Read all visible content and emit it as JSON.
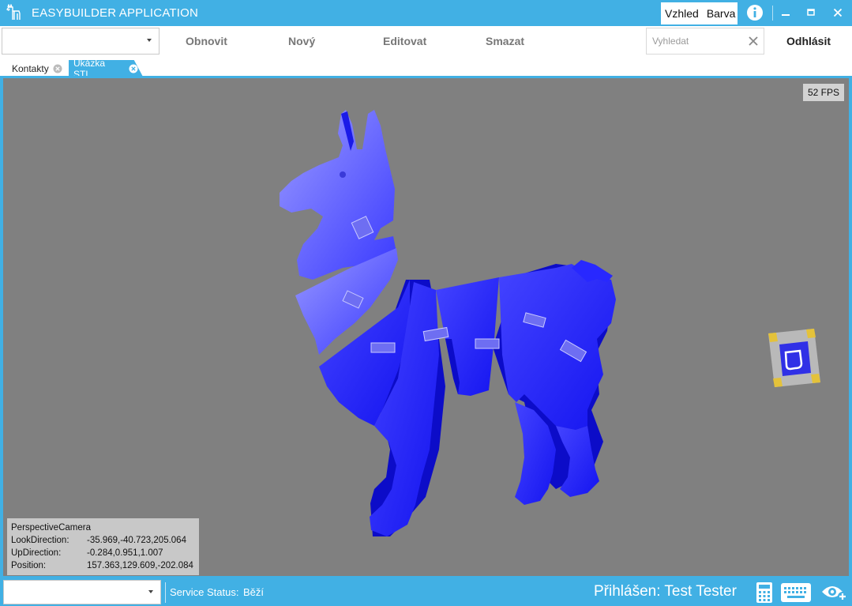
{
  "titlebar": {
    "title": "EASYBUILDER APPLICATION",
    "menu": [
      {
        "label": "Vzhled"
      },
      {
        "label": "Barva"
      }
    ],
    "icons": [
      "llama-logo-icon",
      "info-icon",
      "minimize-icon",
      "maximize-icon",
      "close-icon"
    ]
  },
  "toolbar": {
    "combo_value": "",
    "buttons": [
      {
        "label": "Obnovit"
      },
      {
        "label": "Nový"
      },
      {
        "label": "Editovat"
      },
      {
        "label": "Smazat"
      }
    ],
    "search": {
      "placeholder": "Vyhledat",
      "value": ""
    },
    "logout_label": "Odhlásit"
  },
  "tabs": [
    {
      "label": "Kontakty",
      "active": false
    },
    {
      "label": "Ukázka STL",
      "active": true
    }
  ],
  "viewport": {
    "fps": "52 FPS",
    "camera": {
      "type": "PerspectiveCamera",
      "rows": [
        {
          "key": "LookDirection:",
          "value": "-35.969,-40.723,205.064"
        },
        {
          "key": "UpDirection:",
          "value": "-0.284,0.951,1.007"
        },
        {
          "key": "Position:",
          "value": "157.363,129.609,-202.084"
        }
      ]
    },
    "model_color": "#1a1aff",
    "background_color": "#808080"
  },
  "statusbar": {
    "combo_value": "",
    "service_label": "Service Status:",
    "service_value": "Běží",
    "user_text": "Přihlášen: Test Tester",
    "icons": [
      "calculator-icon",
      "keyboard-icon",
      "eye-plus-icon"
    ]
  },
  "colors": {
    "accent": "#41b0e4"
  }
}
